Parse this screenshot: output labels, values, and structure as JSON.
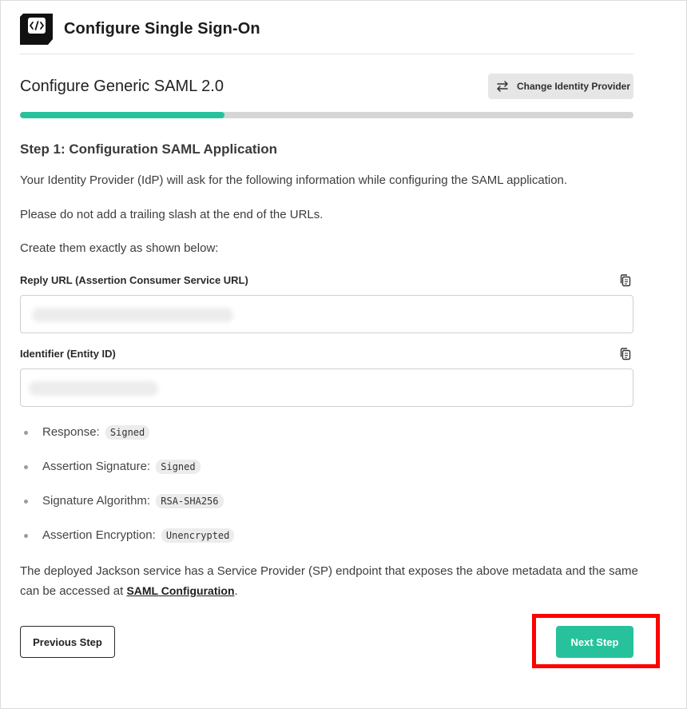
{
  "header": {
    "title": "Configure Single Sign-On",
    "logo_icon": "code-brackets-icon"
  },
  "page": {
    "title": "Configure Generic SAML 2.0",
    "change_provider_label": "Change Identity Provider",
    "progress_fraction": 0.333,
    "accent_color": "#27c29b"
  },
  "step": {
    "title": "Step 1: Configuration SAML Application",
    "intro": "Your Identity Provider (IdP) will ask for the following information while configuring the SAML application.",
    "note": "Please do not add a trailing slash at the end of the URLs.",
    "instruction": "Create them exactly as shown below:"
  },
  "fields": {
    "reply_url": {
      "label": "Reply URL (Assertion Consumer Service URL)",
      "copy_icon": "copy-icon"
    },
    "entity_id": {
      "label": "Identifier (Entity ID)",
      "copy_icon": "copy-icon"
    }
  },
  "settings": [
    {
      "label": "Response:",
      "value": "Signed"
    },
    {
      "label": "Assertion Signature:",
      "value": "Signed"
    },
    {
      "label": "Signature Algorithm:",
      "value": "RSA-SHA256"
    },
    {
      "label": "Assertion Encryption:",
      "value": "Unencrypted"
    }
  ],
  "footer": {
    "text": "The deployed Jackson service has a Service Provider (SP) endpoint that exposes the above metadata and the same can be accessed at",
    "link_text": "SAML Configuration",
    "suffix": "."
  },
  "buttons": {
    "previous": "Previous Step",
    "next": "Next Step"
  },
  "highlight_color": "#ff0000"
}
